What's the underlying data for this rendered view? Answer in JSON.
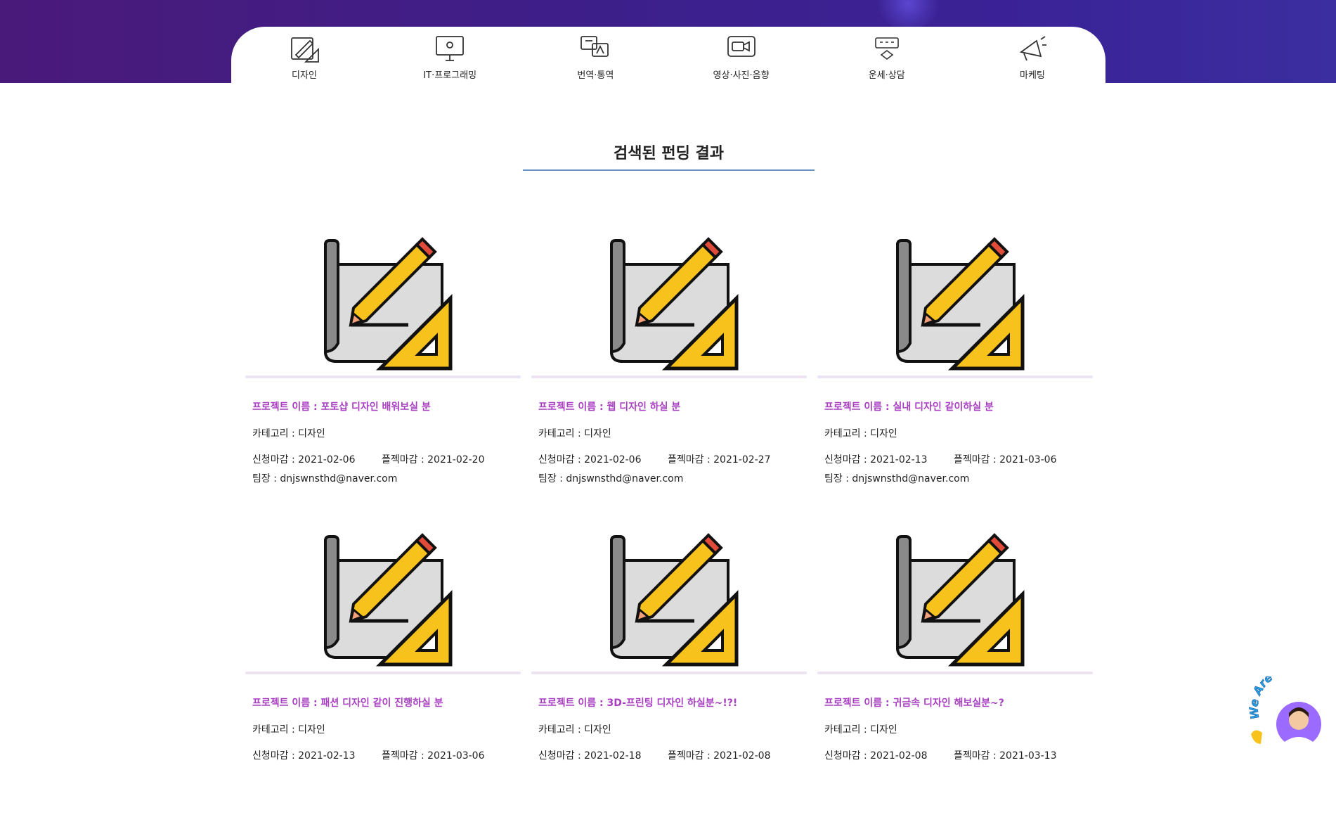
{
  "categories": [
    {
      "label": "디자인",
      "icon": "design-icon"
    },
    {
      "label": "IT·프로그래밍",
      "icon": "monitor-icon"
    },
    {
      "label": "번역·통역",
      "icon": "translate-icon"
    },
    {
      "label": "영상·사진·음향",
      "icon": "video-icon"
    },
    {
      "label": "운세·상담",
      "icon": "fortune-icon"
    },
    {
      "label": "마케팅",
      "icon": "megaphone-icon"
    }
  ],
  "heading": "검색된 펀딩 결과",
  "cards": [
    {
      "title": "프로젝트 이름 : 포토샵 디자인 배워보실 분",
      "category": "카테고리 : 디자인",
      "apply_deadline": "신청마감 : 2021-02-06",
      "project_deadline": "플젝마감 : 2021-02-20",
      "leader": "팀장 : dnjswnsthd@naver.com"
    },
    {
      "title": "프로젝트 이름 : 웹 디자인 하실 분",
      "category": "카테고리 : 디자인",
      "apply_deadline": "신청마감 : 2021-02-06",
      "project_deadline": "플젝마감 : 2021-02-27",
      "leader": "팀장 : dnjswnsthd@naver.com"
    },
    {
      "title": "프로젝트 이름 : 실내 디자인 같이하실 분",
      "category": "카테고리 : 디자인",
      "apply_deadline": "신청마감 : 2021-02-13",
      "project_deadline": "플젝마감 : 2021-03-06",
      "leader": "팀장 : dnjswnsthd@naver.com"
    },
    {
      "title": "프로젝트 이름 : 패션 디자인 같이 진행하실 분",
      "category": "카테고리 : 디자인",
      "apply_deadline": "신청마감 : 2021-02-13",
      "project_deadline": "플젝마감 : 2021-03-06",
      "leader": ""
    },
    {
      "title": "프로젝트 이름 : 3D-프린팅 디자인 하실분~!?!",
      "category": "카테고리 : 디자인",
      "apply_deadline": "신청마감 : 2021-02-18",
      "project_deadline": "플젝마감 : 2021-02-08",
      "leader": ""
    },
    {
      "title": "프로젝트 이름 : 귀금속 디자인 해보실분~?",
      "category": "카테고리 : 디자인",
      "apply_deadline": "신청마감 : 2021-02-08",
      "project_deadline": "플젝마감 : 2021-03-13",
      "leader": ""
    }
  ],
  "badge": {
    "text": "We Are Here!"
  }
}
